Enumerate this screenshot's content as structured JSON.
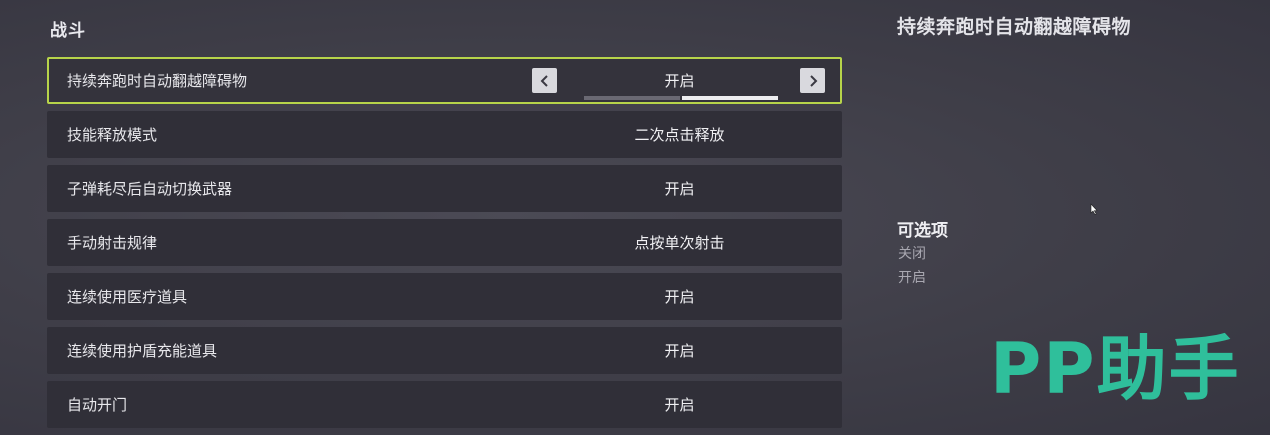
{
  "section": {
    "title": "战斗"
  },
  "settings": [
    {
      "label": "持续奔跑时自动翻越障碍物",
      "value": "开启"
    },
    {
      "label": "技能释放模式",
      "value": "二次点击释放"
    },
    {
      "label": "子弹耗尽后自动切换武器",
      "value": "开启"
    },
    {
      "label": "手动射击规律",
      "value": "点按单次射击"
    },
    {
      "label": "连续使用医疗道具",
      "value": "开启"
    },
    {
      "label": "连续使用护盾充能道具",
      "value": "开启"
    },
    {
      "label": "自动开门",
      "value": "开启"
    }
  ],
  "selected_toggle": {
    "options_count": 2,
    "selected_index": 1
  },
  "detail": {
    "title": "持续奔跑时自动翻越障碍物",
    "options_heading": "可选项",
    "options": [
      "关闭",
      "开启"
    ]
  },
  "watermark": "PP助手",
  "colors": {
    "selected_border": "#b7d44a",
    "row_bg": "#302f38",
    "watermark": "#2fbf9b"
  },
  "icons": {
    "left_arrow": "chevron-left-icon",
    "right_arrow": "chevron-right-icon",
    "cursor": "mouse-cursor-icon"
  }
}
